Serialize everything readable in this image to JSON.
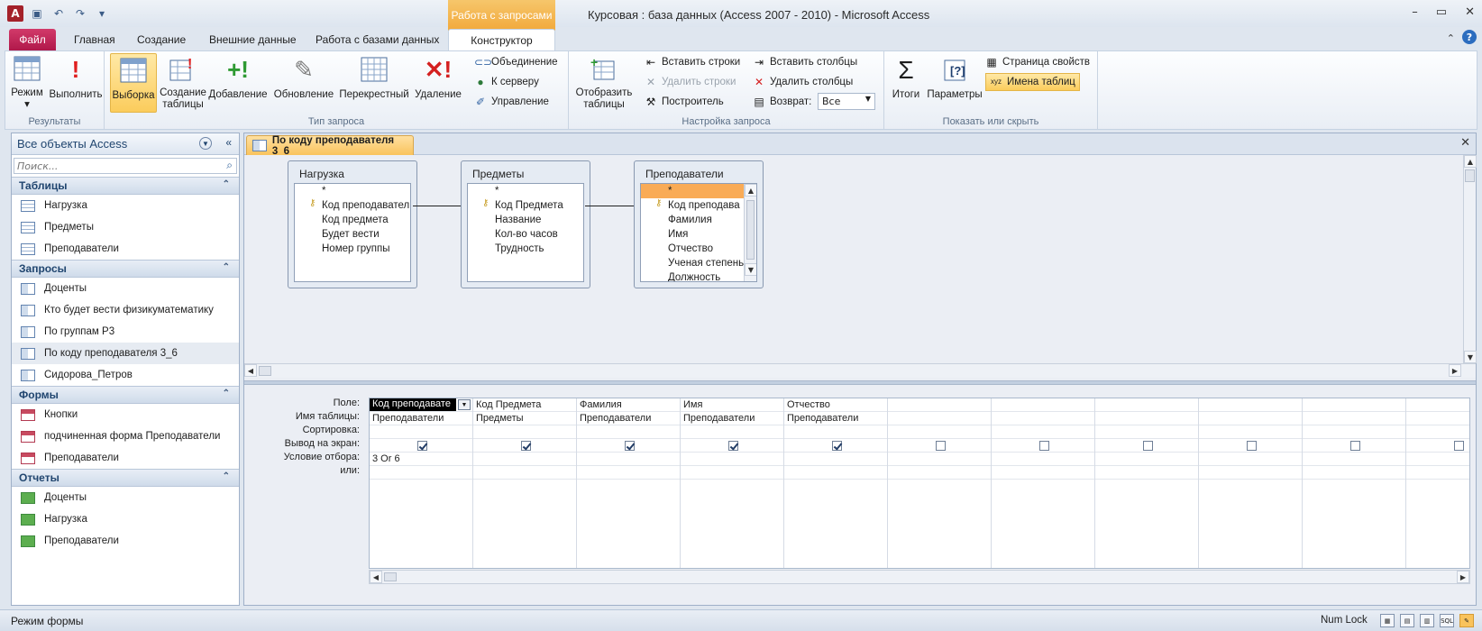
{
  "window": {
    "title": "Курсовая : база данных (Access 2007 - 2010)  -  Microsoft Access",
    "context_group": "Работа с запросами"
  },
  "tabs": [
    "Файл",
    "Главная",
    "Создание",
    "Внешние данные",
    "Работа с базами данных",
    "Конструктор"
  ],
  "ribbon": {
    "groups": {
      "results": "Результаты",
      "query_type": "Тип запроса",
      "query_setup": "Настройка запроса",
      "show_hide": "Показать или скрыть"
    },
    "results": {
      "mode": "Режим",
      "run": "Выполнить"
    },
    "query_type": {
      "select": "Выборка",
      "make_table": "Создание таблицы",
      "append": "Добавление",
      "update": "Обновление",
      "crosstab": "Перекрестный",
      "delete": "Удаление",
      "union": "Объединение",
      "to_server": "К серверу",
      "manage": "Управление"
    },
    "query_setup": {
      "show_table": "Отобразить таблицы",
      "insert_rows": "Вставить строки",
      "delete_rows": "Удалить строки",
      "builder": "Построитель",
      "insert_cols": "Вставить столбцы",
      "delete_cols": "Удалить столбцы",
      "return_label": "Возврат:",
      "return_value": "Все"
    },
    "show_hide": {
      "totals": "Итоги",
      "parameters": "Параметры",
      "property_sheet": "Страница свойств",
      "table_names": "Имена таблиц"
    }
  },
  "nav": {
    "header": "Все объекты Access",
    "search_placeholder": "Поиск...",
    "sections": [
      {
        "name": "Таблицы",
        "items": [
          "Нагрузка",
          "Предметы",
          "Преподаватели"
        ]
      },
      {
        "name": "Запросы",
        "items": [
          "Доценты",
          "Кто будет вести физикуматематику",
          "По группам Р3",
          "По коду преподавателя 3_6",
          "Сидорова_Петров"
        ]
      },
      {
        "name": "Формы",
        "items": [
          "Кнопки",
          "подчиненная форма Преподаватели",
          "Преподаватели"
        ]
      },
      {
        "name": "Отчеты",
        "items": [
          "Доценты",
          "Нагрузка",
          "Преподаватели"
        ]
      }
    ]
  },
  "document": {
    "tab_title": "По коду преподавателя 3_6",
    "tables": [
      {
        "name": "Нагрузка",
        "fields": [
          "*",
          "Код преподавател",
          "Код предмета",
          "Будет вести",
          "Номер группы"
        ]
      },
      {
        "name": "Предметы",
        "fields": [
          "*",
          "Код Предмета",
          "Название",
          "Кол-во часов",
          "Трудность"
        ]
      },
      {
        "name": "Преподаватели",
        "fields": [
          "*",
          "Код преподава",
          "Фамилия",
          "Имя",
          "Отчество",
          "Ученая степень",
          "Должность"
        ]
      }
    ],
    "grid": {
      "row_labels": [
        "Поле:",
        "Имя таблицы:",
        "Сортировка:",
        "Вывод на экран:",
        "Условие отбора:",
        "или:"
      ],
      "columns": [
        {
          "field": "Код преподавате",
          "table": "Преподаватели",
          "show": true,
          "criteria": "3 Or 6"
        },
        {
          "field": "Код Предмета",
          "table": "Предметы",
          "show": true,
          "criteria": ""
        },
        {
          "field": "Фамилия",
          "table": "Преподаватели",
          "show": true,
          "criteria": ""
        },
        {
          "field": "Имя",
          "table": "Преподаватели",
          "show": true,
          "criteria": ""
        },
        {
          "field": "Отчество",
          "table": "Преподаватели",
          "show": true,
          "criteria": ""
        },
        {
          "field": "",
          "table": "",
          "show": false,
          "criteria": ""
        },
        {
          "field": "",
          "table": "",
          "show": false,
          "criteria": ""
        },
        {
          "field": "",
          "table": "",
          "show": false,
          "criteria": ""
        },
        {
          "field": "",
          "table": "",
          "show": false,
          "criteria": ""
        },
        {
          "field": "",
          "table": "",
          "show": false,
          "criteria": ""
        },
        {
          "field": "",
          "table": "",
          "show": false,
          "criteria": ""
        }
      ]
    }
  },
  "status": {
    "left": "Режим формы",
    "numlock": "Num Lock",
    "sql_label": "SQL"
  }
}
